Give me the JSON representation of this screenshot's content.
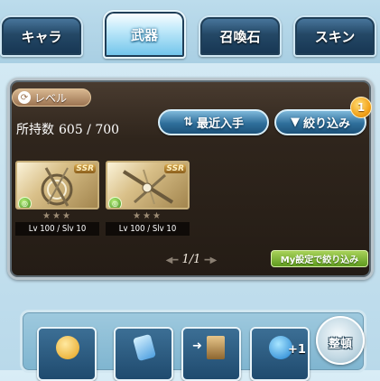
{
  "tabs": [
    {
      "label": "キャラ",
      "active": false
    },
    {
      "label": "武器",
      "active": true
    },
    {
      "label": "召喚石",
      "active": false
    },
    {
      "label": "スキン",
      "active": false
    }
  ],
  "toolbar": {
    "level_sort_label": "レベル",
    "owned_label": "所持数",
    "owned_count": "605 / 700",
    "sort_label": "最近入手",
    "filter_label": "絞り込み",
    "filter_badge": "1"
  },
  "weapons": [
    {
      "rarity": "SSR",
      "level": "Lv 100 / Slv 10",
      "stars": "★★★",
      "element_icon": "wind-element-icon"
    },
    {
      "rarity": "SSR",
      "level": "Lv 100 / Slv 10",
      "stars": "★★★",
      "element_icon": "wind-element-icon"
    }
  ],
  "pager": {
    "text": "1/1"
  },
  "my_setting_filter_label": "My設定で絞り込み",
  "bottom_bar": {
    "sort_round_label": "整頓",
    "buttons": [
      {
        "icon": "gold-coin-icon"
      },
      {
        "icon": "crystal-icon"
      },
      {
        "icon": "storage-box-icon"
      },
      {
        "icon": "blue-orb-plus-icon"
      }
    ]
  },
  "colors": {
    "panel_bg": "#2f251c",
    "active_tab": "#6ec3ea",
    "button_blue": "#2f6f9b",
    "badge_orange": "#f3a31b",
    "my_setting_green": "#5f9a1f"
  }
}
